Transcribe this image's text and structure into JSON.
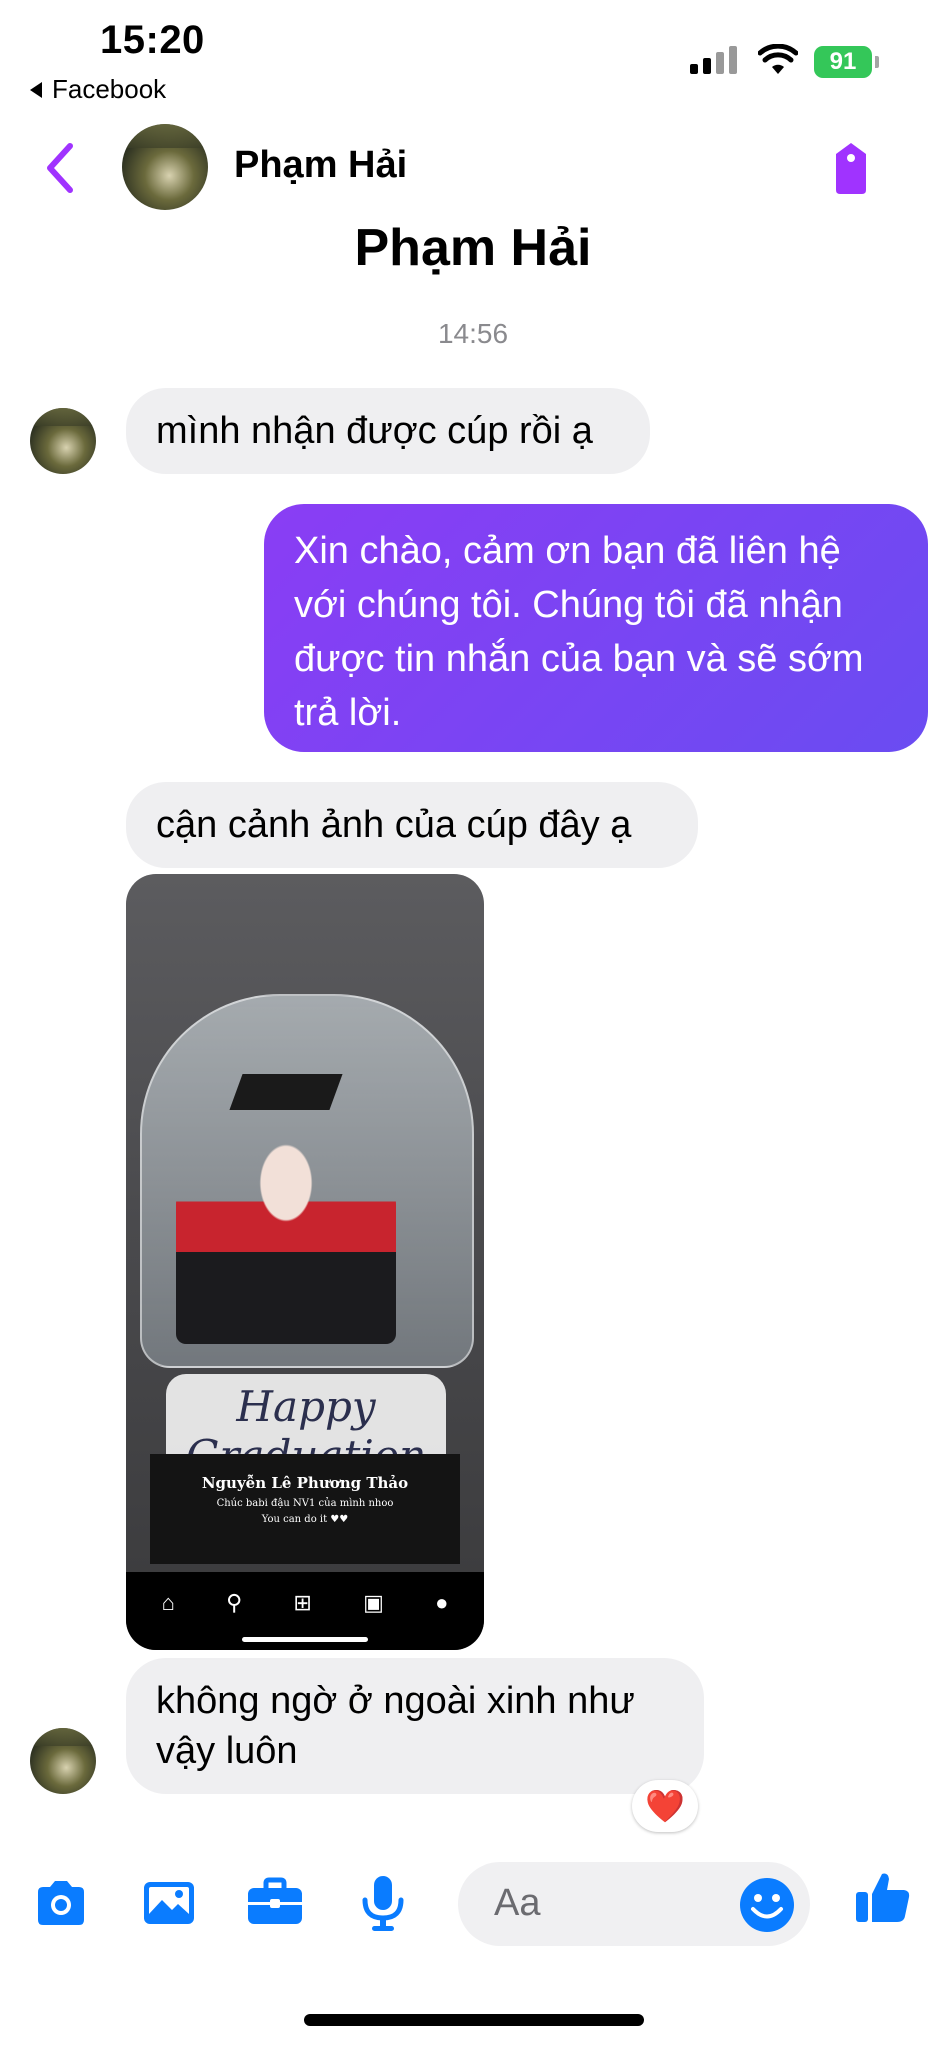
{
  "status_bar": {
    "time": "15:20",
    "back_app": "Facebook",
    "battery": "91"
  },
  "header": {
    "contact_name": "Phạm Hải"
  },
  "conversation": {
    "profile_name": "Phạm Hải",
    "timestamp": "14:56",
    "messages": [
      {
        "from": "contact",
        "text": "mình nhận được cúp rồi ạ"
      },
      {
        "from": "me",
        "text": "Xin chào, cảm ơn bạn đã liên hệ với chúng tôi. Chúng tôi đã nhận được tin nhắn của bạn và sẽ sớm trả lời."
      },
      {
        "from": "contact",
        "text": "cận cảnh ảnh của cúp đây ạ"
      },
      {
        "from": "contact",
        "text": "không ngờ ở ngoài xinh như vậy luôn",
        "reaction": "❤️"
      }
    ],
    "photo": {
      "artwork_text": "Happy Graduation",
      "plate_line1": "Nguyễn Lê Phương Thảo",
      "plate_line2": "Chúc babi đậu NV1 của mình nhoo",
      "plate_line3": "You can do it ♥♥"
    }
  },
  "composer": {
    "placeholder": "Aa",
    "icons": [
      "camera-icon",
      "gallery-icon",
      "briefcase-icon",
      "microphone-icon",
      "emoji-icon",
      "like-icon"
    ]
  },
  "colors": {
    "accent": "#a033ff",
    "outgoing_bubble": "#7a45f3",
    "incoming_bubble": "#efeff1",
    "messenger_blue": "#0a7cff"
  }
}
